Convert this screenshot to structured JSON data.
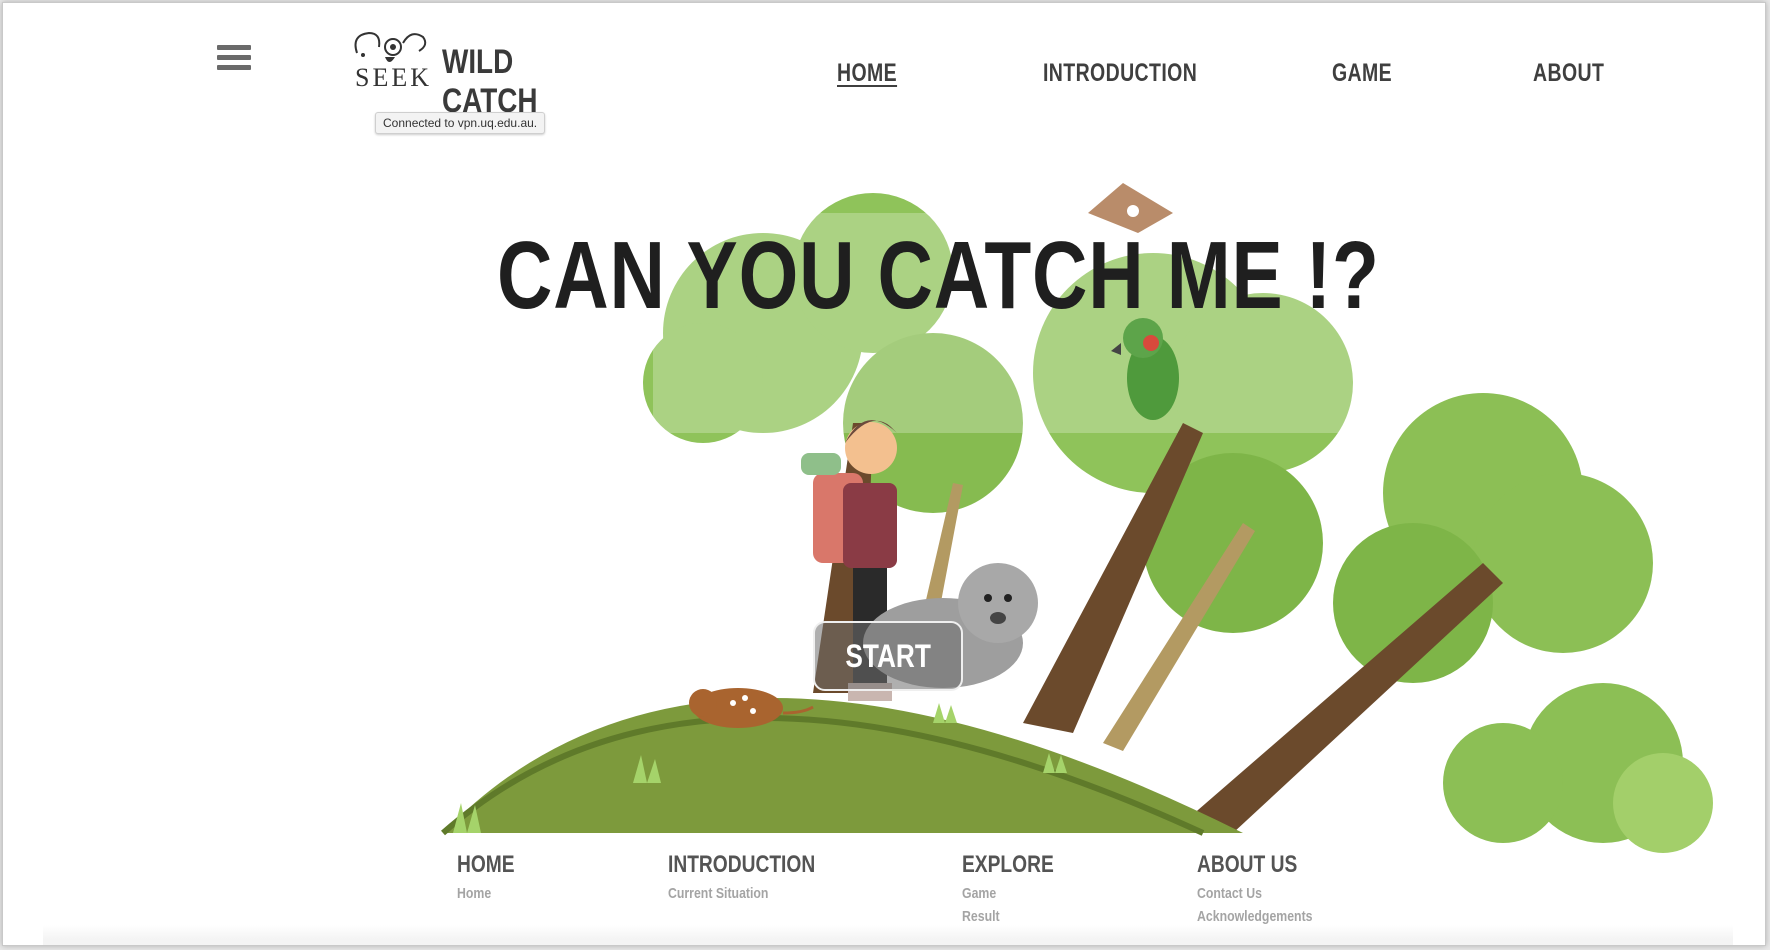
{
  "header": {
    "menu_icon": "hamburger-menu-icon",
    "logo": {
      "seek_text": "SEEK",
      "title": "WILD CATCH"
    },
    "tooltip": "Connected to vpn.uq.edu.au.",
    "nav": [
      {
        "label": "HOME",
        "active": true
      },
      {
        "label": "INTRODUCTION",
        "active": false
      },
      {
        "label": "GAME",
        "active": false
      },
      {
        "label": "ABOUT",
        "active": false
      }
    ]
  },
  "hero": {
    "title": "CAN YOU CATCH ME !?",
    "start_label": "START",
    "illustration": "bushland-with-hiker-wombat-quoll-parrot-glider"
  },
  "footer": {
    "columns": [
      {
        "heading": "HOME",
        "links": [
          "Home"
        ]
      },
      {
        "heading": "INTRODUCTION",
        "links": [
          "Current Situation"
        ]
      },
      {
        "heading": "EXPLORE",
        "links": [
          "Game",
          "Result"
        ]
      },
      {
        "heading": "ABOUT US",
        "links": [
          "Contact Us",
          "Acknowledgements"
        ]
      }
    ]
  },
  "colors": {
    "title": "#1f1f1f",
    "nav": "#3f3f3f",
    "tree_light": "#8cbf55",
    "tree_dark": "#6a9a3a",
    "trunk": "#6b4a2c",
    "hill": "#7d9a3c",
    "footer_heading": "#545454",
    "footer_link": "#a4a4a4"
  }
}
